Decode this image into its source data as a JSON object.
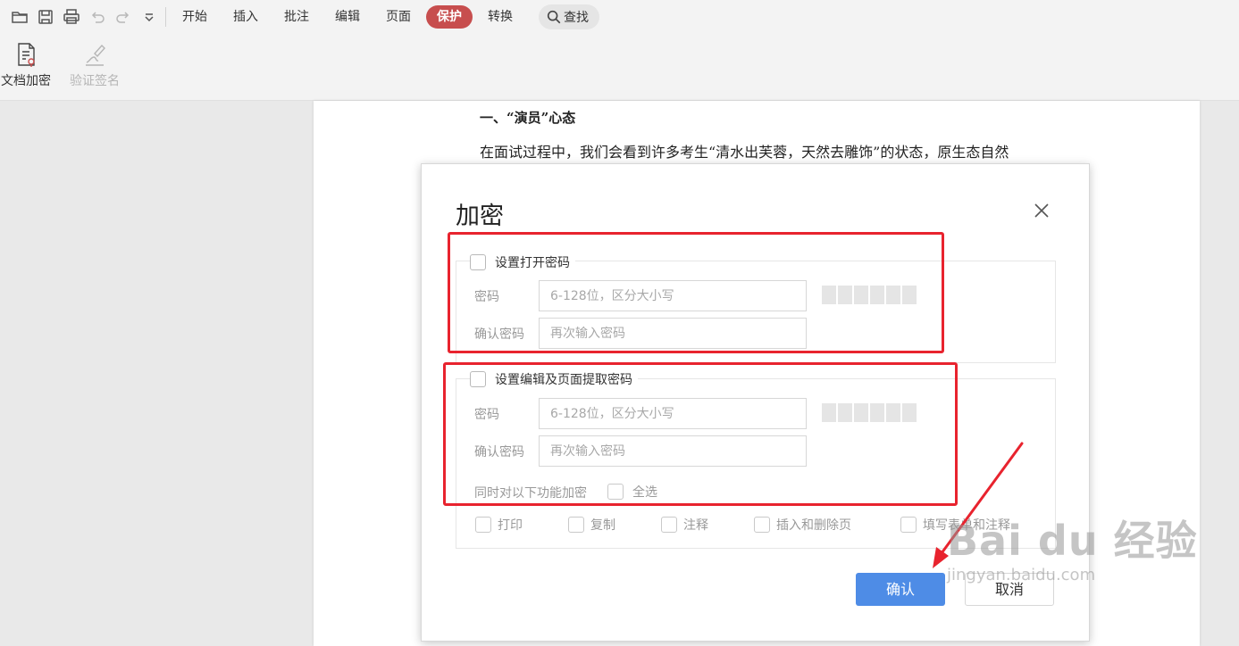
{
  "toolbar": {
    "quick_access_icons": [
      "open-folder-icon",
      "save-icon",
      "print-icon",
      "undo-icon",
      "redo-icon",
      "dropdown-icon"
    ],
    "tabs": [
      {
        "label": "开始",
        "active": false
      },
      {
        "label": "插入",
        "active": false
      },
      {
        "label": "批注",
        "active": false
      },
      {
        "label": "编辑",
        "active": false
      },
      {
        "label": "页面",
        "active": false
      },
      {
        "label": "保护",
        "active": true
      },
      {
        "label": "转换",
        "active": false
      }
    ],
    "search_label": "查找",
    "active_color": "#c74e4e"
  },
  "ribbon": {
    "encrypt_label": "文档加密",
    "verify_label": "验证签名"
  },
  "document": {
    "heading": "一、“演员”心态",
    "paragraph": "在面试过程中，我们会看到许多考生“清水出芙蓉，天然去雕饰”的状态，原生态自然"
  },
  "dialog": {
    "title": "加密",
    "open_section": {
      "checkbox_label": "设置打开密码",
      "password_label": "密码",
      "password_placeholder": "6-128位，区分大小写",
      "confirm_label": "确认密码",
      "confirm_placeholder": "再次输入密码"
    },
    "edit_section": {
      "checkbox_label": "设置编辑及页面提取密码",
      "password_label": "密码",
      "password_placeholder": "6-128位，区分大小写",
      "confirm_label": "确认密码",
      "confirm_placeholder": "再次输入密码",
      "features_label": "同时对以下功能加密",
      "select_all_label": "全选",
      "features": [
        "打印",
        "复制",
        "注释",
        "插入和删除页",
        "填写表单和注释"
      ]
    },
    "ok_label": "确认",
    "cancel_label": "取消",
    "ok_color": "#4e8ce6"
  },
  "annotation": {
    "color": "#e8232e"
  },
  "watermark": {
    "main": "Bai du 经验",
    "sub": "jingyan.baidu.com"
  }
}
